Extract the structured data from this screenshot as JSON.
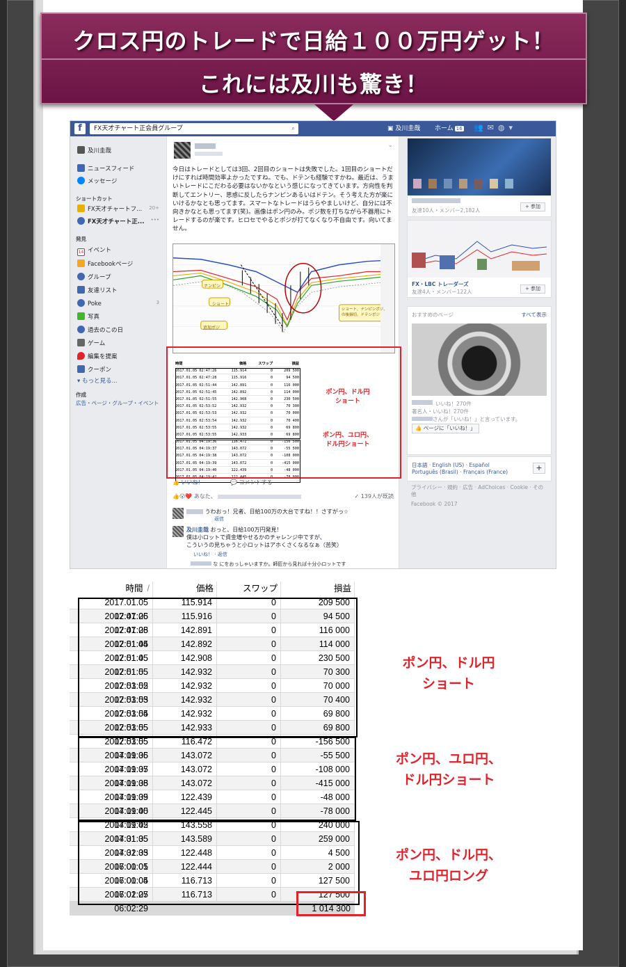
{
  "banner": {
    "line1": "クロス円のトレードで日給１００万円ゲット！",
    "line2": "これには及川も驚き！"
  },
  "fb": {
    "search_text": "FX天才チャート正会員グループ",
    "user_name": "及川圭哉",
    "home_label": "ホーム",
    "home_badge": "16",
    "left": {
      "profile": "及川圭哉",
      "news_feed": "ニュースフィード",
      "messages": "メッセージ",
      "shortcuts_title": "ショートカット",
      "shortcut1": "FX天才チャートフ...",
      "shortcut1_count": "20+",
      "shortcut2": "FX天才チャート正...",
      "discover_title": "発見",
      "events": "イベント",
      "events_icon_text": "14",
      "fb_pages": "Facebookページ",
      "groups": "グループ",
      "friend_lists": "友達リスト",
      "poke": "Poke",
      "poke_count": "3",
      "photos": "写真",
      "on_this_day": "過去のこの日",
      "games": "ゲーム",
      "suggest_edits": "編集を提案",
      "coupons": "クーポン",
      "see_more": "もっと見る...",
      "create_title": "作成",
      "create_links": "広告・ページ・グループ・イベント"
    },
    "post_text": "今日はトレードとしては3回、2回目のショートは失敗でした。1回目のショートだけにすれば時間効率よかったですね。でも、ドテンも経験ですかね。最近は、うまいトレードにこだわる必要はないかなという感じになってきています。方向性を判断してエントリー、思惑に反したらナンピンあるいはドテン。そう考えた方が楽にいけるかなとも思ってます。スマートなトレードはうらやましいけど、自分には不向きかなとも思ってます(笑)。画像はポン円のみ。ポジ数を打ちながら不器用にトレードするのが楽です。ヒロセでやるとポジが打てなくなり不自由です。向いてません。",
    "chart_labels": {
      "nanpin": "ナンピン",
      "short": "ショート",
      "add_pos": "追加ポジ",
      "right_note": "ショート、ナンピンポジ、\nの後損切、ドテンポジ"
    },
    "mini_headers": [
      "時間",
      "価格",
      "スワップ",
      "損益"
    ],
    "mini_label1": "ポン円、ドル円\nショート",
    "mini_label2": "ポン円、ユロ円、\nドル円ショート",
    "like_action": "いいね！",
    "comment_action": "コメントする",
    "reactions_prefix": "あなた、",
    "seen_count": "139人が既読",
    "comment1": "うわおっ！兄者、日給100万の大台ですね！！さすがっ☆",
    "reply_label": "返信",
    "comment2_name": "及川圭哉",
    "comment2": "おっと、日給100万円発見！\n僕は小ロットで資金増やせるかのチャレンジ中ですが、\nこういうの見ちゃうと小ロットはアホくさくなるなぁ（苦笑）",
    "comment2_actions": "いいね！ · 返信",
    "comment3": "な にをおっしゃいますか。師匠から見れば十分小ロットです",
    "right": {
      "join_label": "+ 参加",
      "group1_stats": "友達10人・メンバー2,182人",
      "group2_name": "FX・LBC トレーダーズ",
      "group2_stats": "友達4人・メンバー122人",
      "recommended_title": "おすすめのページ",
      "see_all": "すべて表示",
      "page_likes": "いいね！270件",
      "page_famous": "著名人・いいね！270件",
      "page_friend_like": "さんが「いいね！」と言っています。",
      "like_page_btn": "ページに「いいね！」",
      "langs1": "日本語 · English (US) · Español",
      "langs2": "Português (Brasil) · Français (France)",
      "footer_links": "プライバシー · 規約 · 広告 · AdChoices · Cookie · その他",
      "copyright": "Facebook © 2017"
    }
  },
  "table": {
    "headers": [
      "時間",
      "価格",
      "スワップ",
      "損益"
    ],
    "rows": [
      [
        "2017.01.05 02:47:26",
        "115.914",
        "0",
        "209 500"
      ],
      [
        "2017.01.05 02:47:28",
        "115.916",
        "0",
        "94 500"
      ],
      [
        "2017.01.05 02:51:44",
        "142.891",
        "0",
        "116 000"
      ],
      [
        "2017.01.05 02:51:45",
        "142.892",
        "0",
        "114 000"
      ],
      [
        "2017.01.05 02:51:55",
        "142.908",
        "0",
        "230 500"
      ],
      [
        "2017.01.05 02:53:52",
        "142.932",
        "0",
        "70 300"
      ],
      [
        "2017.01.05 02:53:53",
        "142.932",
        "0",
        "70 000"
      ],
      [
        "2017.01.05 02:53:54",
        "142.932",
        "0",
        "70 400"
      ],
      [
        "2017.01.05 02:53:55",
        "142.932",
        "0",
        "69 800"
      ],
      [
        "2017.01.05 02:53:55",
        "142.933",
        "0",
        "69 800"
      ],
      [
        "2017.01.05 04:19:36",
        "116.472",
        "0",
        "-156 500"
      ],
      [
        "2017.01.05 04:19:37",
        "143.072",
        "0",
        "-55 500"
      ],
      [
        "2017.01.05 04:19:38",
        "143.072",
        "0",
        "-108 000"
      ],
      [
        "2017.01.05 04:19:39",
        "143.072",
        "0",
        "-415 000"
      ],
      [
        "2017.01.05 04:19:40",
        "122.439",
        "0",
        "-48 000"
      ],
      [
        "2017.01.05 04:19:42",
        "122.445",
        "0",
        "-78 000"
      ],
      [
        "2017.01.05 04:31:35",
        "143.558",
        "0",
        "240 000"
      ],
      [
        "2017.01.05 04:32:33",
        "143.589",
        "0",
        "259 000"
      ],
      [
        "2017.01.05 06:00:01",
        "122.448",
        "0",
        "4 500"
      ],
      [
        "2017.01.05 06:00:04",
        "122.444",
        "0",
        "2 000"
      ],
      [
        "2017.01.05 06:02:27",
        "116.713",
        "0",
        "127 500"
      ],
      [
        "2017.01.05 06:02:29",
        "116.713",
        "0",
        "127 500"
      ]
    ],
    "total": "1 014 300"
  },
  "labels": {
    "group1": "ポン円、ドル円\nショート",
    "group2": "ポン円、ユロ円、\nドル円ショート",
    "group3": "ポン円、ドル円、\nユロ円ロング"
  },
  "colors": {
    "banner": "#6b1445",
    "accent_red": "#e0232a",
    "fb_blue": "#3b5998"
  }
}
